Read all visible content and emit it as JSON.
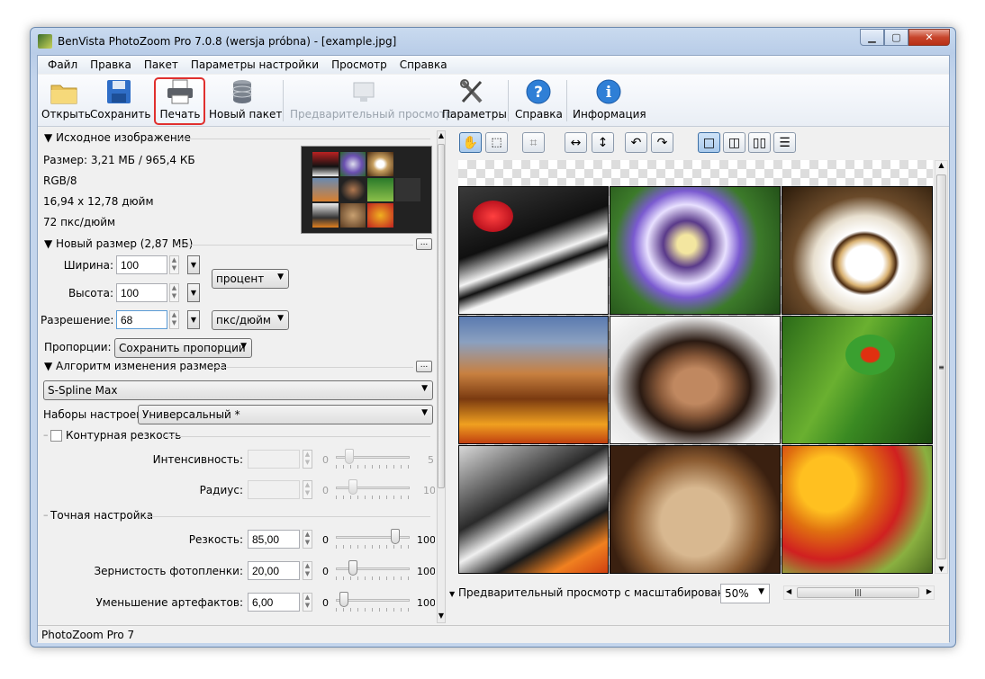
{
  "window": {
    "title": "BenVista PhotoZoom Pro 7.0.8 (wersja próbna) - [example.jpg]"
  },
  "menu": [
    "Файл",
    "Правка",
    "Пакет",
    "Параметры настройки",
    "Просмотр",
    "Справка"
  ],
  "toolbar": {
    "open": "Открыть",
    "save": "Сохранить",
    "print": "Печать",
    "batch": "Новый пакет",
    "preview": "Предварительный просмотр",
    "settings": "Параметры",
    "help": "Справка",
    "info": "Информация"
  },
  "source": {
    "header": "Исходное изображение",
    "size": "Размер: 3,21 МБ / 965,4 КБ",
    "mode": "RGB/8",
    "dims": "16,94 x 12,78 дюйм",
    "res": "72 пкс/дюйм"
  },
  "newsize": {
    "header": "Новый размер (2,87 МБ)",
    "width_label": "Ширина:",
    "width": "100",
    "height_label": "Высота:",
    "height": "100",
    "unit": "процент",
    "res_label": "Разрешение:",
    "res": "68",
    "res_unit": "пкс/дюйм",
    "prop_label": "Пропорции:",
    "prop": "Сохранить пропорции"
  },
  "algo": {
    "header": "Алгоритм изменения размера",
    "method": "S-Spline Max",
    "presets_label": "Наборы настроек:",
    "preset": "Универсальный *"
  },
  "sharp": {
    "header": "Контурная резкость",
    "intensity_label": "Интенсивность:",
    "radius_label": "Радиус:",
    "min0": "0",
    "imax": "5",
    "rmax": "10"
  },
  "fine": {
    "header": "Точная настройка",
    "s_label": "Резкость:",
    "s_val": "85,00",
    "f_label": "Зернистость фотопленки:",
    "f_val": "20,00",
    "a_label": "Уменьшение артефактов:",
    "a_val": "6,00",
    "min": "0",
    "max": "100"
  },
  "slider_levels": {
    "sharpness": 0.85,
    "grain": 0.2,
    "artifacts": 0.06
  },
  "preview": {
    "zoom_label": "Предварительный просмотр с масштабированием:",
    "zoom": "50%"
  },
  "status": "PhotoZoom Pro 7",
  "colors": {
    "highlight": "#e0302e",
    "accent": "#1c6bc4"
  }
}
